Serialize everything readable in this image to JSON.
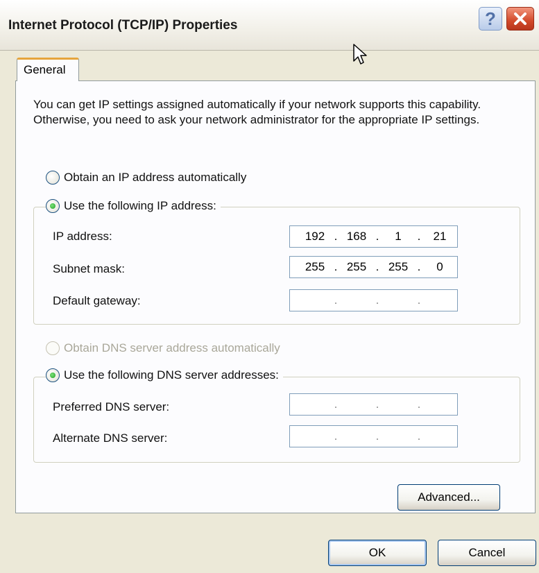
{
  "window": {
    "title": "Internet Protocol (TCP/IP) Properties",
    "help_label": "?"
  },
  "tabs": [
    {
      "label": "General",
      "active": true
    }
  ],
  "intro_text": "You can get IP settings assigned automatically if your network supports this capability. Otherwise, you need to ask your network administrator for the appropriate IP settings.",
  "ip_section": {
    "auto_label": "Obtain an IP address automatically",
    "manual_label": "Use the following IP address:",
    "selected": "manual",
    "fields": [
      {
        "label": "IP address:",
        "octets": [
          "192",
          "168",
          "1",
          "21"
        ]
      },
      {
        "label": "Subnet mask:",
        "octets": [
          "255",
          "255",
          "255",
          "0"
        ]
      },
      {
        "label": "Default gateway:",
        "octets": [
          "",
          "",
          "",
          ""
        ]
      }
    ]
  },
  "dns_section": {
    "auto_label": "Obtain DNS server address automatically",
    "auto_enabled": false,
    "manual_label": "Use the following DNS server addresses:",
    "selected": "manual",
    "fields": [
      {
        "label": "Preferred DNS server:",
        "octets": [
          "",
          "",
          "",
          ""
        ]
      },
      {
        "label": "Alternate DNS server:",
        "octets": [
          "",
          "",
          "",
          ""
        ]
      }
    ]
  },
  "buttons": {
    "advanced": "Advanced...",
    "ok": "OK",
    "cancel": "Cancel"
  },
  "colors": {
    "title_close": "#d24a2a",
    "tab_accent": "#e6a53c",
    "radio_checked": "#21a121",
    "field_border": "#7f9db9"
  }
}
